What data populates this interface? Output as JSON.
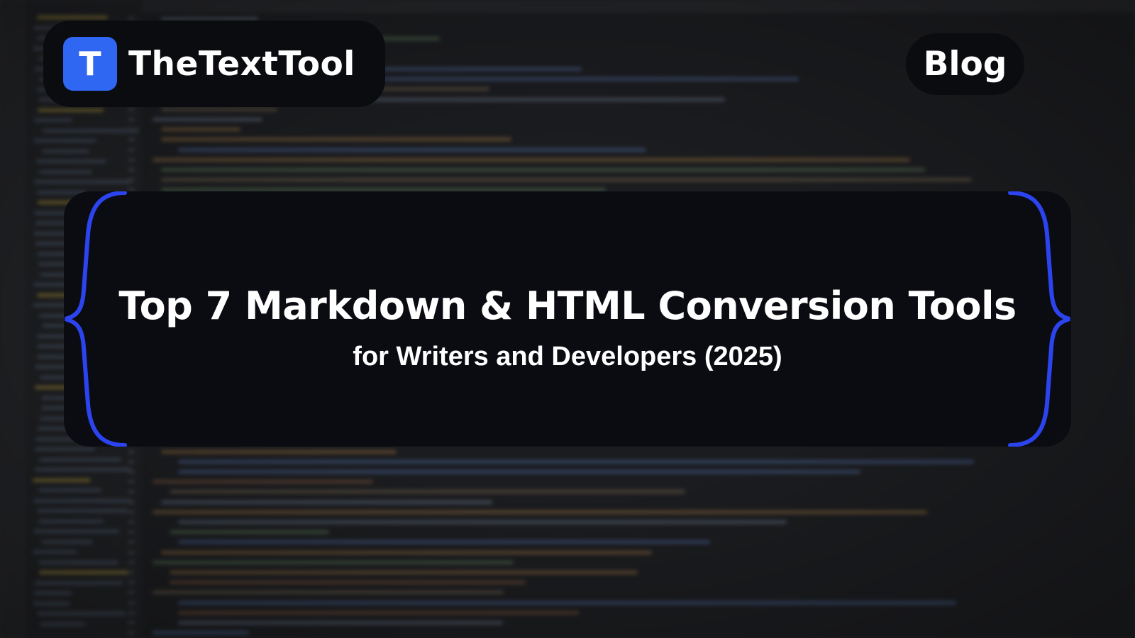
{
  "brand": {
    "logo_letter": "T",
    "name": "TheTextTool",
    "accent_color": "#2f67f2"
  },
  "nav": {
    "blog_label": "Blog"
  },
  "hero": {
    "title": "Top 7 Markdown & HTML Conversion Tools",
    "subtitle": "for Writers and Developers (2025)",
    "brace_color": "#2b44f0"
  },
  "background": {
    "description_icon": "blurred-code-editor"
  }
}
